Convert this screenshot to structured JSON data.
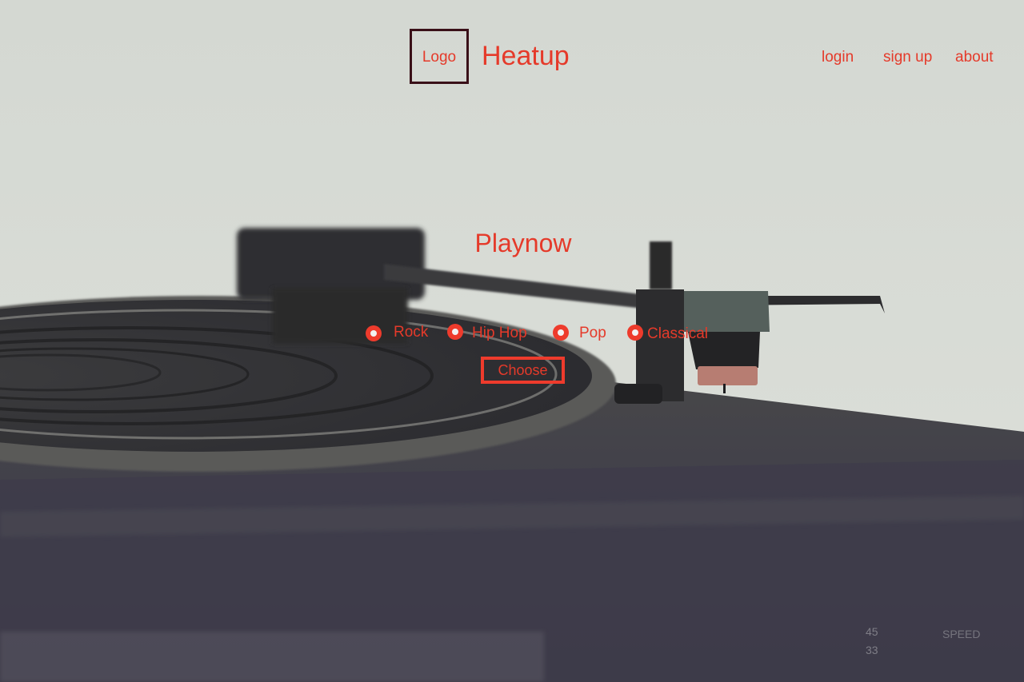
{
  "header": {
    "logo_label": "Logo",
    "brand": "Heatup",
    "nav": {
      "login": "login",
      "signup": "sign up",
      "about": "about"
    }
  },
  "main": {
    "title": "Playnow",
    "genres": [
      {
        "label": "Rock"
      },
      {
        "label": "Hip Hop"
      },
      {
        "label": "Pop"
      },
      {
        "label": "Classical"
      }
    ],
    "choose_button": "Choose"
  },
  "colors": {
    "accent": "#e53a2a",
    "logo_border": "#3a1018"
  },
  "background_image": "turntable-photo"
}
